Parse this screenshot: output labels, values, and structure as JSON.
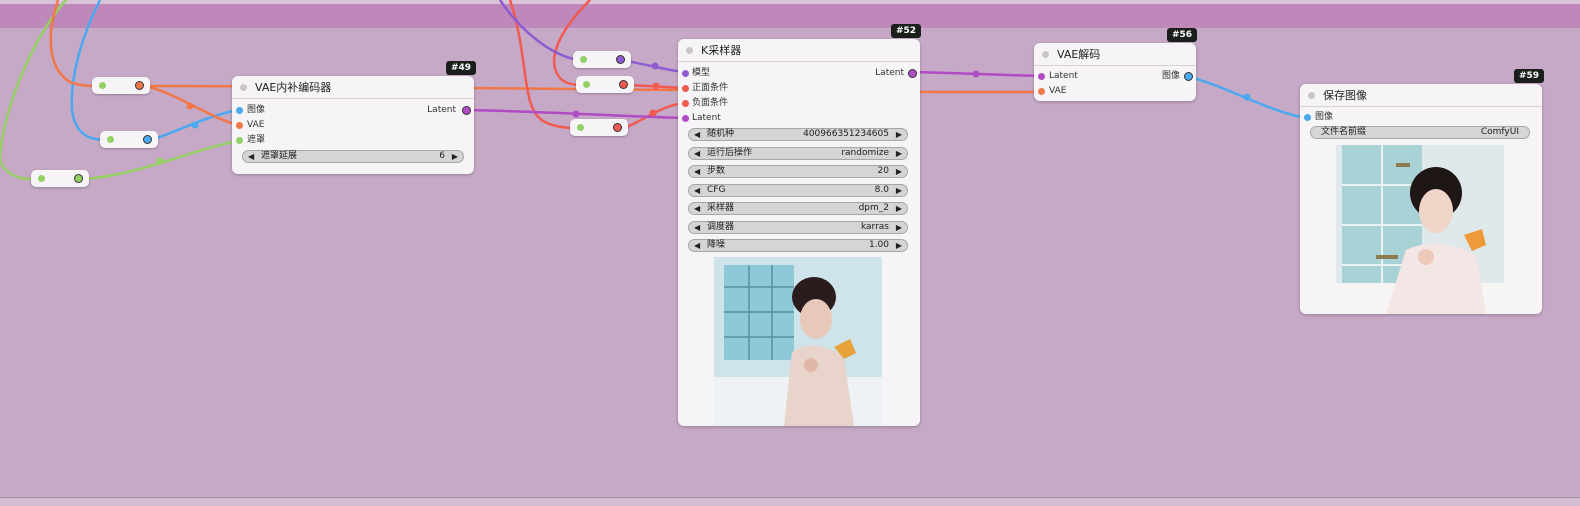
{
  "colors": {
    "canvas": "#c6a9c6",
    "band": "#bf88bb",
    "image_port": "#4aa8f0",
    "vae_port": "#f07848",
    "mask_port": "#94d064",
    "model_port": "#8e5cd0",
    "positive_port": "#f05a50",
    "latent_port": "#b04cc4"
  },
  "nodes": {
    "vae_encode": {
      "badge": "#49",
      "title": "VAE内补编码器",
      "inputs": [
        "图像",
        "VAE",
        "遮罩"
      ],
      "output": "Latent",
      "widget": {
        "label": "遮罩延展",
        "value": "6"
      }
    },
    "ksampler": {
      "badge": "#52",
      "title": "K采样器",
      "inputs": [
        "模型",
        "正面条件",
        "负面条件",
        "Latent"
      ],
      "output": "Latent",
      "widgets": [
        {
          "label": "随机种",
          "value": "400966351234605"
        },
        {
          "label": "运行后操作",
          "value": "randomize"
        },
        {
          "label": "步数",
          "value": "20"
        },
        {
          "label": "CFG",
          "value": "8.0"
        },
        {
          "label": "采样器",
          "value": "dpm_2"
        },
        {
          "label": "调度器",
          "value": "karras"
        },
        {
          "label": "降噪",
          "value": "1.00"
        }
      ]
    },
    "vae_decode": {
      "badge": "#56",
      "title": "VAE解码",
      "inputs": [
        "Latent",
        "VAE"
      ],
      "output": "图像"
    },
    "save_image": {
      "badge": "#59",
      "title": "保存图像",
      "inputs": [
        "图像"
      ],
      "widget": {
        "label": "文件名前缀",
        "value": "ComfyUI"
      }
    }
  },
  "arrows": {
    "left": "◀",
    "right": "▶"
  }
}
